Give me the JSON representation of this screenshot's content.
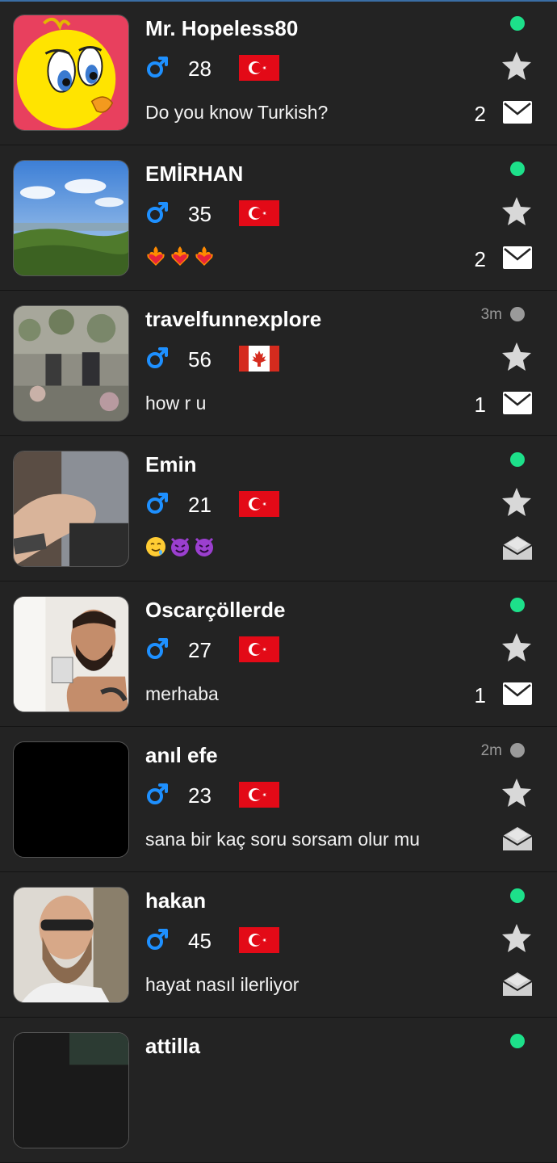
{
  "users": [
    {
      "name": "Mr. Hopeless80",
      "age": "28",
      "country": "turkey",
      "message": "Do you know Turkish?",
      "unread": "2",
      "status": "online",
      "last_seen": "",
      "avatar": "tweety"
    },
    {
      "name": "EMİRHAN",
      "age": "35",
      "country": "turkey",
      "message": "",
      "emojis": [
        "heart-on-fire",
        "heart-on-fire",
        "heart-on-fire"
      ],
      "unread": "2",
      "status": "online",
      "last_seen": "",
      "avatar": "landscape"
    },
    {
      "name": "travelfunnexplore",
      "age": "56",
      "country": "canada",
      "message": "how r u",
      "unread": "1",
      "status": "offline",
      "last_seen": "3m",
      "avatar": "garden"
    },
    {
      "name": "Emin",
      "age": "21",
      "country": "turkey",
      "message": "",
      "emojis": [
        "drooling-face",
        "smiling-imp",
        "smiling-imp"
      ],
      "unread": "",
      "status": "online",
      "last_seen": "",
      "avatar": "hand"
    },
    {
      "name": "Oscarçöllerde",
      "age": "27",
      "country": "turkey",
      "message": "merhaba",
      "unread": "1",
      "status": "online",
      "last_seen": "",
      "avatar": "bearded-man"
    },
    {
      "name": "anıl efe",
      "age": "23",
      "country": "turkey",
      "message": "sana bir kaç soru sorsam olur mu",
      "unread": "",
      "status": "offline",
      "last_seen": "2m",
      "avatar": "black"
    },
    {
      "name": "hakan",
      "age": "45",
      "country": "turkey",
      "message": "hayat nasıl ilerliyor",
      "unread": "",
      "status": "online",
      "last_seen": "",
      "avatar": "bald-beard"
    },
    {
      "name": "attilla",
      "age": "",
      "country": "",
      "message": "",
      "unread": "",
      "status": "online",
      "last_seen": "",
      "avatar": "dark"
    }
  ],
  "icons": {
    "gender": "male-symbol-icon",
    "favorite": "star-icon",
    "unread_mail": "closed-envelope-icon",
    "read_mail": "open-envelope-icon"
  },
  "colors": {
    "background": "#232323",
    "online": "#1de08a",
    "offline": "#9a9a9a",
    "gender_blue": "#1e90ff",
    "star": "#d8d8d8"
  }
}
